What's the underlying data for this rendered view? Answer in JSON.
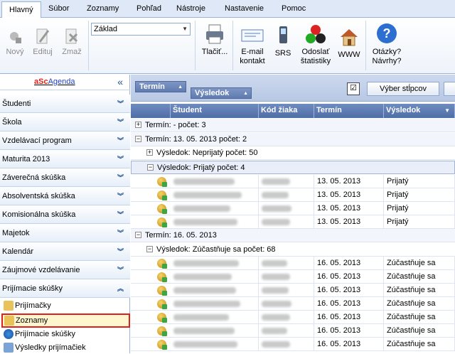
{
  "menu": {
    "tabs": [
      "Hlavný",
      "Súbor",
      "Zoznamy",
      "Pohľad",
      "Nástroje",
      "Nastavenie",
      "Pomoc"
    ],
    "active": "Hlavný"
  },
  "ribbon": {
    "new_label": "Nový",
    "edit_label": "Edituj",
    "delete_label": "Zmaž",
    "combo_value": "Základ",
    "print_label": "Tlačiť...",
    "email_label_1": "E-mail",
    "email_label_2": "kontakt",
    "srs_label": "SRS",
    "stats_label_1": "Odoslať",
    "stats_label_2": "štatistiky",
    "www_label": "WWW",
    "help_label_1": "Otázky?",
    "help_label_2": "Návrhy?"
  },
  "sidebar": {
    "brand_prefix": "aSc",
    "brand_suffix": "Agenda",
    "collapse_symbol": "«",
    "items": [
      "Študenti",
      "Škola",
      "Vzdelávací program",
      "Maturita 2013",
      "Záverečná skúška",
      "Absolventská skúška",
      "Komisionálna skúška",
      "Majetok",
      "Kalendár",
      "Záujmové vzdelávanie",
      "Prijímacie skúšky"
    ],
    "subitems": [
      "Prijímačky",
      "Zoznamy",
      "Prijímacie skúšky",
      "Výsledky prijímačiek"
    ],
    "selected_subitem": "Zoznamy"
  },
  "grid": {
    "group_chips": [
      "Termín",
      "Výsledok"
    ],
    "column_chooser_label": "Výber stĺpcov",
    "columns": [
      "Študent",
      "Kód žiaka",
      "Termín",
      "Výsledok"
    ],
    "groups": [
      {
        "label": "Termín: - počet: 3",
        "expanded": false
      },
      {
        "label": "Termín: 13. 05. 2013 počet: 2",
        "expanded": true
      },
      {
        "label": "Výsledok: Neprijatý počet: 50",
        "expanded": false
      },
      {
        "label": "Výsledok: Prijatý počet: 4",
        "expanded": true
      },
      {
        "label": "Termín: 16. 05. 2013",
        "expanded": true
      },
      {
        "label": "Výsledok: Zúčastňuje sa počet: 68",
        "expanded": true
      }
    ],
    "rows_prijaty": [
      {
        "termin": "13. 05. 2013",
        "vysledok": "Prijatý"
      },
      {
        "termin": "13. 05. 2013",
        "vysledok": "Prijatý"
      },
      {
        "termin": "13. 05. 2013",
        "vysledok": "Prijatý"
      },
      {
        "termin": "13. 05. 2013",
        "vysledok": "Prijatý"
      }
    ],
    "rows_zucastnuje": [
      {
        "termin": "16. 05. 2013",
        "vysledok": "Zúčastňuje sa"
      },
      {
        "termin": "16. 05. 2013",
        "vysledok": "Zúčastňuje sa"
      },
      {
        "termin": "16. 05. 2013",
        "vysledok": "Zúčastňuje sa"
      },
      {
        "termin": "16. 05. 2013",
        "vysledok": "Zúčastňuje sa"
      },
      {
        "termin": "16. 05. 2013",
        "vysledok": "Zúčastňuje sa"
      },
      {
        "termin": "16. 05. 2013",
        "vysledok": "Zúčastňuje sa"
      },
      {
        "termin": "16. 05. 2013",
        "vysledok": "Zúčastňuje sa"
      }
    ]
  },
  "colors": {
    "accent": "#dfe8f6",
    "header": "#4f6ea6",
    "selected_border": "#e0201b",
    "brand_red": "#e0201b",
    "brand_blue": "#1f3fbf"
  }
}
